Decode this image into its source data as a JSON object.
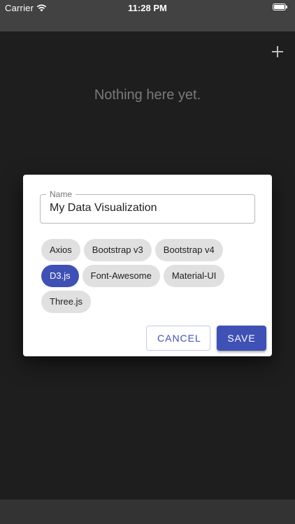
{
  "status_bar": {
    "carrier": "Carrier",
    "time": "11:28 PM",
    "wifi_icon": "wifi-icon",
    "battery_icon": "battery-icon"
  },
  "main": {
    "add_icon": "plus-icon",
    "empty_message": "Nothing here yet."
  },
  "dialog": {
    "name_label": "Name",
    "name_value": "My Data Visualization",
    "chips": [
      {
        "label": "Axios",
        "selected": false
      },
      {
        "label": "Bootstrap v3",
        "selected": false
      },
      {
        "label": "Bootstrap v4",
        "selected": false
      },
      {
        "label": "D3.js",
        "selected": true
      },
      {
        "label": "Font-Awesome",
        "selected": false
      },
      {
        "label": "Material-UI",
        "selected": false
      },
      {
        "label": "Three.js",
        "selected": false
      }
    ],
    "cancel_label": "CANCEL",
    "save_label": "SAVE"
  },
  "colors": {
    "accent": "#3f51b5",
    "chip_bg": "#e0e0e0",
    "background": "#1e1e1e",
    "bar": "#424242"
  }
}
